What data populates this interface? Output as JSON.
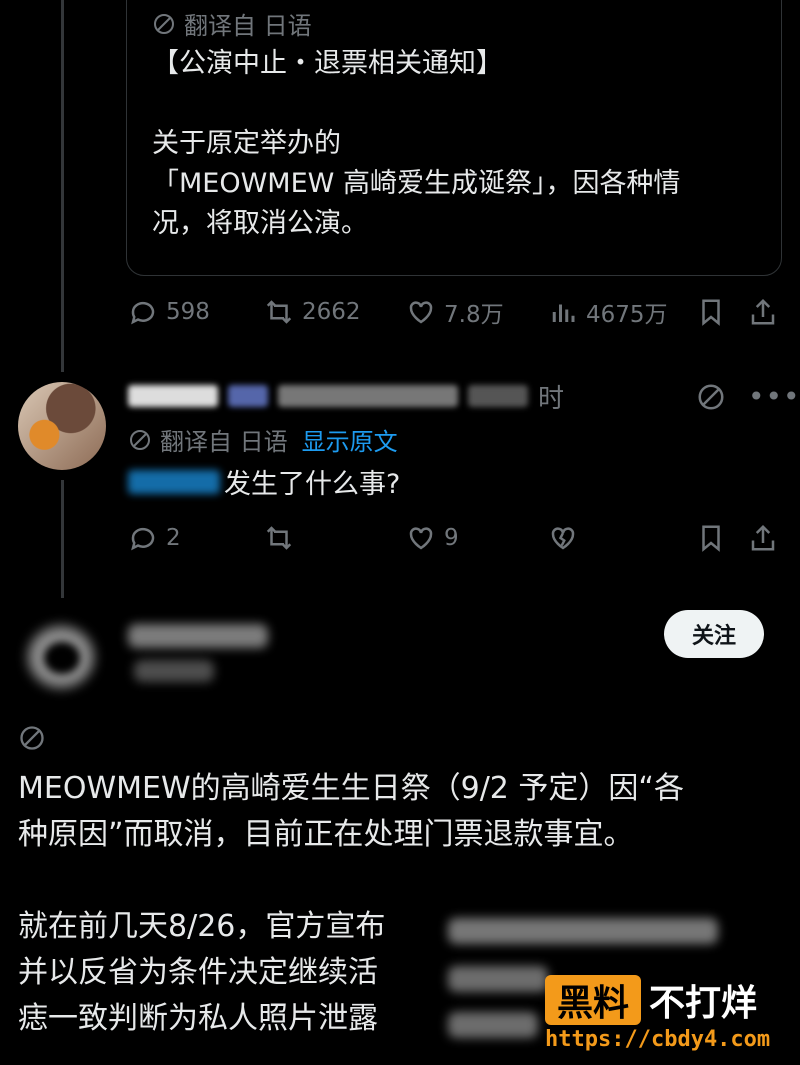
{
  "quoted_post": {
    "translated_label": "翻译自 日语",
    "text": "【公演中止・退票相关通知】\n\n关于原定举办的\n「MEOWMEW 高崎爱生成诞祭」，因各种情\n况，将取消公演。"
  },
  "main_post_actions": {
    "replies": "598",
    "reposts": "2662",
    "likes": "7.8万",
    "views": "4675万"
  },
  "reply": {
    "time_suffix": "时",
    "translated_label": "翻译自 日语",
    "show_original": "显示原文",
    "text": "发生了什么事?",
    "replies": "2",
    "likes": "9"
  },
  "follow_button": "关注",
  "post": {
    "text": "MEOWMEW的高崎爱生生日祭（9/2 予定）因“各\n种原因”而取消，目前正在处理门票退款事宜。\n\n就在前几天8/26，官方宣布\n并以反省为条件决定继续活\n痣一致判断为私人照片泄露"
  },
  "watermark": {
    "box": "黑料",
    "rest": "不打烊",
    "url": "https://cbdy4.com"
  },
  "colors": {
    "background": "#000000",
    "text": "#e7e9ea",
    "muted": "#71767b",
    "link": "#1d9bf0",
    "accent": "#f39a1a"
  }
}
